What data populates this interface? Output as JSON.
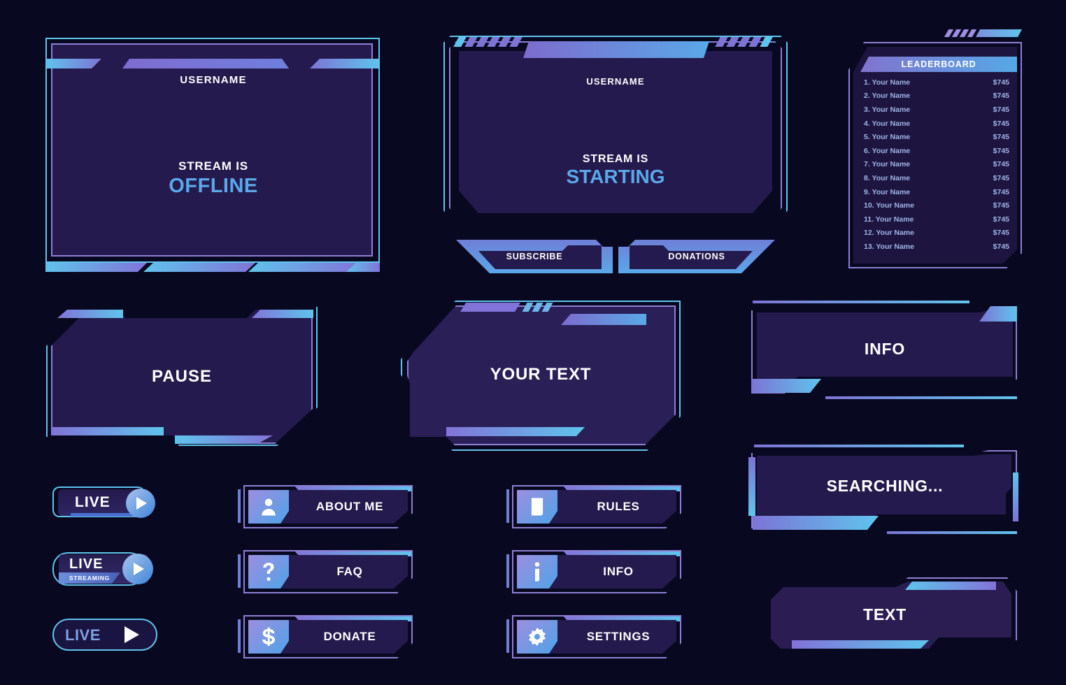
{
  "theme": {
    "background": "#080820",
    "panel_fill": "#241a4d",
    "outline_blue": "#5fc4ec",
    "outline_purple": "#8f7fd4",
    "accent_blue": "#5aa8e8",
    "text_white": "#ffffff",
    "leaderboard_text": "#9fb4e8"
  },
  "offline_panel": {
    "username": "USERNAME",
    "line1": "STREAM IS",
    "line2": "OFFLINE"
  },
  "starting_panel": {
    "username": "USERNAME",
    "line1": "STREAM IS",
    "line2": "STARTING",
    "subscribe_label": "SUBSCRIBE",
    "donations_label": "DONATIONS"
  },
  "leaderboard": {
    "title": "LEADERBOARD",
    "rows": [
      {
        "name": "1. Your Name",
        "amount": "$745"
      },
      {
        "name": "2. Your Name",
        "amount": "$745"
      },
      {
        "name": "3. Your Name",
        "amount": "$745"
      },
      {
        "name": "4. Your Name",
        "amount": "$745"
      },
      {
        "name": "5. Your Name",
        "amount": "$745"
      },
      {
        "name": "6. Your Name",
        "amount": "$745"
      },
      {
        "name": "7. Your Name",
        "amount": "$745"
      },
      {
        "name": "8. Your Name",
        "amount": "$745"
      },
      {
        "name": "9. Your Name",
        "amount": "$745"
      },
      {
        "name": "10. Your Name",
        "amount": "$745"
      },
      {
        "name": "11. Your Name",
        "amount": "$745"
      },
      {
        "name": "12. Your Name",
        "amount": "$745"
      },
      {
        "name": "13. Your Name",
        "amount": "$745"
      }
    ]
  },
  "pause_panel": {
    "label": "PAUSE"
  },
  "yourtext_panel": {
    "label": "YOUR TEXT"
  },
  "info_bar": {
    "label": "INFO"
  },
  "searching_bar": {
    "label": "SEARCHING..."
  },
  "text_bar": {
    "label": "TEXT"
  },
  "live_badges": [
    {
      "label": "LIVE",
      "sub": "",
      "icon": "play-icon"
    },
    {
      "label": "LIVE",
      "sub": "STREAMING",
      "icon": "play-icon"
    },
    {
      "label": "LIVE",
      "sub": "",
      "icon": "play-icon"
    }
  ],
  "menu_buttons_left": [
    {
      "label": "ABOUT ME",
      "icon": "user-icon"
    },
    {
      "label": "FAQ",
      "icon": "question-mark-icon"
    },
    {
      "label": "DONATE",
      "icon": "dollar-icon"
    }
  ],
  "menu_buttons_right": [
    {
      "label": "RULES",
      "icon": "document-icon"
    },
    {
      "label": "INFO",
      "icon": "info-icon"
    },
    {
      "label": "SETTINGS",
      "icon": "gear-icon"
    }
  ]
}
